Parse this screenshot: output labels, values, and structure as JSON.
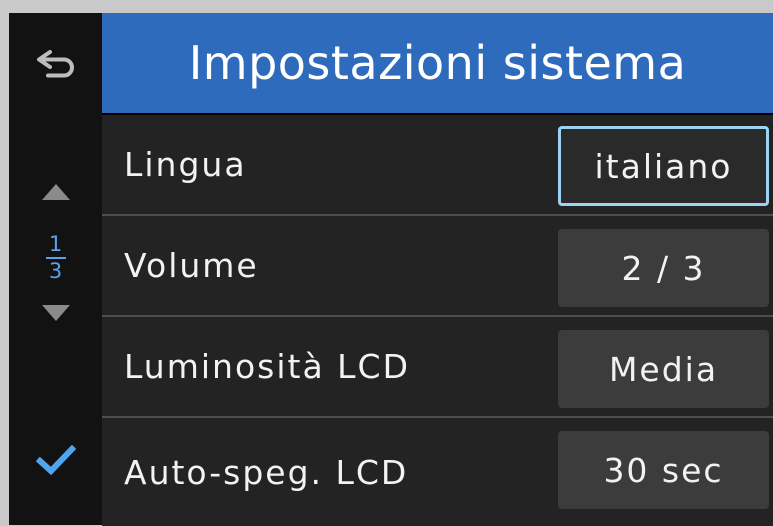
{
  "header": {
    "title": "Impostazioni sistema"
  },
  "sidebar": {
    "back_icon": "back-arrow-icon",
    "up_icon": "triangle-up-icon",
    "page": {
      "current": "1",
      "total": "3"
    },
    "down_icon": "triangle-down-icon",
    "confirm_icon": "checkmark-icon"
  },
  "settings": [
    {
      "label": "Lingua",
      "value": "italiano",
      "selected": true
    },
    {
      "label": "Volume",
      "value": "2 / 3",
      "selected": false
    },
    {
      "label": "Luminosità LCD",
      "value": "Media",
      "selected": false
    },
    {
      "label": "Auto-speg. LCD",
      "value": "30 sec",
      "selected": false
    }
  ],
  "colors": {
    "header_bg": "#2f6bbd",
    "accent": "#5aa2e8",
    "selected_border": "#9cd3f2",
    "row_bg": "#232323",
    "value_bg": "#3c3c3c"
  }
}
